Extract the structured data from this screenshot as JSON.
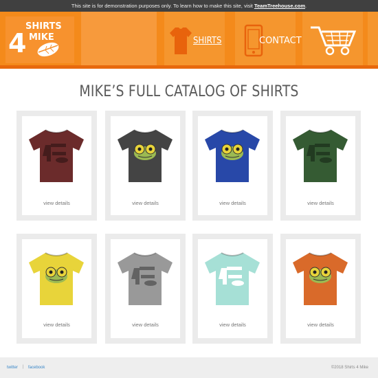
{
  "notice": {
    "text": "This site is for demonstration purposes only. To learn how to make this site, visit",
    "link": "TeamTreehouse.com",
    "period": "."
  },
  "logo": {
    "line1": "SHIRTS",
    "number": "4",
    "line2": "MIKE"
  },
  "nav": {
    "shirts": "SHIRTS",
    "contact": "CONTACT"
  },
  "page": {
    "title": "MIKE’S FULL CATALOG OF SHIRTS"
  },
  "products": [
    {
      "color": "#6b2b2b",
      "print": "logo",
      "details": "view details"
    },
    {
      "color": "#444444",
      "print": "frog",
      "details": "view details"
    },
    {
      "color": "#2848a8",
      "print": "frog",
      "details": "view details"
    },
    {
      "color": "#355b33",
      "print": "logo",
      "details": "view details"
    },
    {
      "color": "#e8d43a",
      "print": "frog",
      "details": "view details"
    },
    {
      "color": "#999999",
      "print": "logo",
      "details": "view details"
    },
    {
      "color": "#a6e0d6",
      "print": "logo",
      "details": "view details"
    },
    {
      "color": "#d96a2a",
      "print": "frog",
      "details": "view details"
    }
  ],
  "footer": {
    "twitter": "twitter",
    "separator": "|",
    "facebook": "facebook",
    "copyright": "©2018 Shirts 4 Mike"
  },
  "colors": {
    "brand": "#f48a1b",
    "notice": "#404040",
    "link": "#3a87c8"
  }
}
